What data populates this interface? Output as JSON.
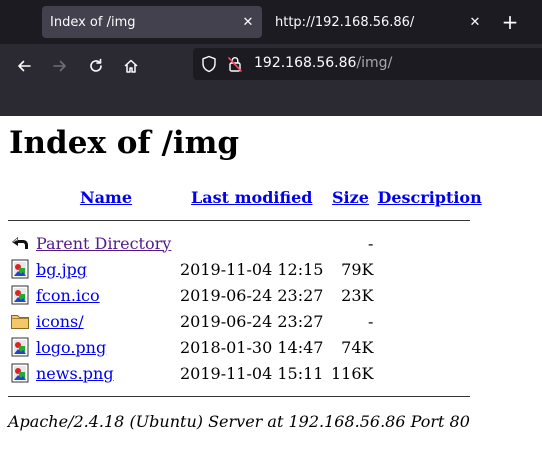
{
  "browser": {
    "tabs": [
      {
        "title": "Index of /img",
        "active": true
      },
      {
        "title": "http://192.168.56.86/",
        "active": false
      }
    ],
    "url": {
      "host": "192.168.56.86",
      "path": "/img/"
    },
    "icons": {
      "back": "arrow-left-icon",
      "forward": "arrow-right-icon",
      "reload": "reload-icon",
      "home": "home-icon",
      "tracking": "shield-icon",
      "insecure": "lock-slash-icon",
      "close": "close-icon",
      "newtab": "plus-icon"
    }
  },
  "page": {
    "title": "Index of /img",
    "columns": {
      "name": "Name",
      "modified": "Last modified",
      "size": "Size",
      "description": "Description"
    },
    "rows": [
      {
        "icon": "back-icon",
        "name": "Parent Directory",
        "modified": "",
        "size": "-",
        "description": ""
      },
      {
        "icon": "image-file-icon",
        "name": "bg.jpg",
        "modified": "2019-11-04 12:15",
        "size": "79K",
        "description": ""
      },
      {
        "icon": "image-file-icon",
        "name": "fcon.ico",
        "modified": "2019-06-24 23:27",
        "size": "23K",
        "description": ""
      },
      {
        "icon": "folder-icon",
        "name": "icons/",
        "modified": "2019-06-24 23:27",
        "size": "-",
        "description": ""
      },
      {
        "icon": "image-file-icon",
        "name": "logo.png",
        "modified": "2018-01-30 14:47",
        "size": "74K",
        "description": ""
      },
      {
        "icon": "image-file-icon",
        "name": "news.png",
        "modified": "2019-11-04 15:11",
        "size": "116K",
        "description": ""
      }
    ],
    "footer": "Apache/2.4.18 (Ubuntu) Server at 192.168.56.86 Port 80"
  }
}
